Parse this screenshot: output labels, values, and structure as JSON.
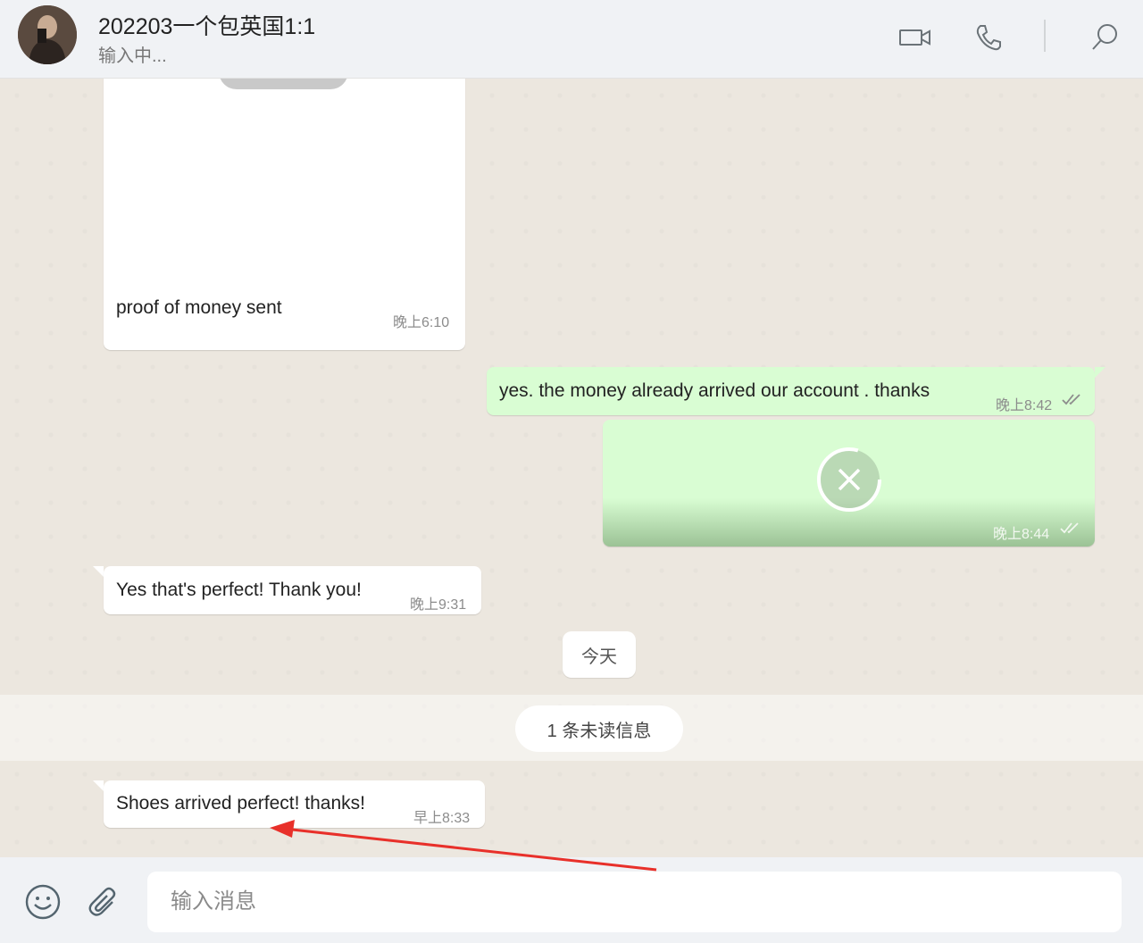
{
  "header": {
    "contact_name": "202203一个包英国1:1",
    "status": "输入中..."
  },
  "messages": [
    {
      "direction": "in",
      "type": "image",
      "caption": "proof of money sent",
      "time": "晚上6:10"
    },
    {
      "direction": "out",
      "type": "text",
      "text": "yes. the money already arrived our account . thanks",
      "time": "晚上8:42",
      "status": "read"
    },
    {
      "direction": "out",
      "type": "media",
      "time": "晚上8:44",
      "status": "read"
    },
    {
      "direction": "in",
      "type": "text",
      "text": "Yes that's perfect! Thank you!",
      "time": "晚上9:31"
    },
    {
      "direction": "in",
      "type": "text",
      "text": "Shoes arrived perfect! thanks!",
      "time": "早上8:33"
    }
  ],
  "date_divider": "今天",
  "unread_divider": "1 条未读信息",
  "composer": {
    "placeholder": "输入消息"
  },
  "icons": {
    "video_call": "video-camera-icon",
    "voice_call": "phone-icon",
    "search": "search-icon",
    "emoji": "emoji-icon",
    "attach": "paperclip-icon",
    "media_cancel": "close-icon",
    "read_receipt": "double-check-icon"
  },
  "colors": {
    "outgoing_bubble": "#d9fdd3",
    "incoming_bubble": "#ffffff",
    "annotation_arrow": "#e8302a"
  }
}
